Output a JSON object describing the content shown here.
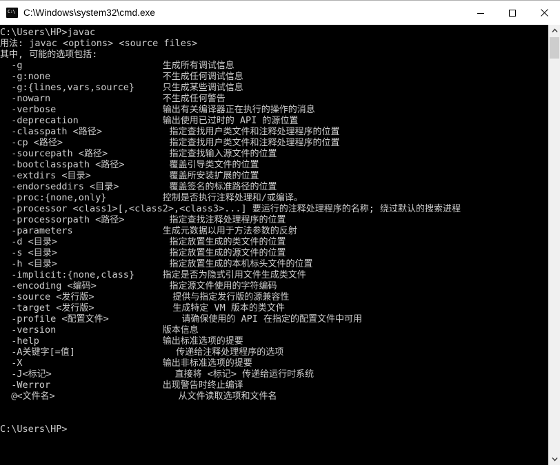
{
  "window": {
    "title": "C:\\Windows\\system32\\cmd.exe",
    "icon_name": "cmd-icon",
    "icon_glyph": "C:\\",
    "background_color": "#000000",
    "titlebar_color": "#ffffff",
    "text_color": "#cccccc",
    "controls": {
      "minimize_label": "Minimize",
      "maximize_label": "Maximize",
      "close_label": "Close"
    }
  },
  "scrollbar": {
    "up_arrow_label": "Scroll up",
    "down_arrow_label": "Scroll down",
    "thumb_label": "Scroll thumb"
  },
  "console": {
    "lines": [
      "C:\\Users\\HP>javac",
      "用法: javac <options> <source files>",
      "其中, 可能的选项包括:",
      "  -g                         生成所有调试信息",
      "  -g:none                    不生成任何调试信息",
      "  -g:{lines,vars,source}     只生成某些调试信息",
      "  -nowarn                    不生成任何警告",
      "  -verbose                   输出有关编译器正在执行的操作的消息",
      "  -deprecation               输出使用已过时的 API 的源位置",
      "  -classpath <路径>            指定查找用户类文件和注释处理程序的位置",
      "  -cp <路径>                   指定查找用户类文件和注释处理程序的位置",
      "  -sourcepath <路径>           指定查找输入源文件的位置",
      "  -bootclasspath <路径>        覆盖引导类文件的位置",
      "  -extdirs <目录>              覆盖所安装扩展的位置",
      "  -endorseddirs <目录>         覆盖签名的标准路径的位置",
      "  -proc:{none,only}          控制是否执行注释处理和/或编译。",
      "  -processor <class1>[,<class2>,<class3>...] 要运行的注释处理程序的名称; 绕过默认的搜索进程",
      "  -processorpath <路径>        指定查找注释处理程序的位置",
      "  -parameters                生成元数据以用于方法参数的反射",
      "  -d <目录>                    指定放置生成的类文件的位置",
      "  -s <目录>                    指定放置生成的源文件的位置",
      "  -h <目录>                    指定放置生成的本机标头文件的位置",
      "  -implicit:{none,class}     指定是否为隐式引用文件生成类文件",
      "  -encoding <编码>             指定源文件使用的字符编码",
      "  -source <发行版>              提供与指定发行版的源兼容性",
      "  -target <发行版>              生成特定 VM 版本的类文件",
      "  -profile <配置文件>             请确保使用的 API 在指定的配置文件中可用",
      "  -version                   版本信息",
      "  -help                      输出标准选项的提要",
      "  -A关键字[=值]                  传递给注释处理程序的选项",
      "  -X                         输出非标准选项的提要",
      "  -J<标记>                      直接将 <标记> 传递给运行时系统",
      "  -Werror                    出现警告时终止编译",
      "  @<文件名>                      从文件读取选项和文件名",
      "",
      "",
      "C:\\Users\\HP>"
    ]
  }
}
